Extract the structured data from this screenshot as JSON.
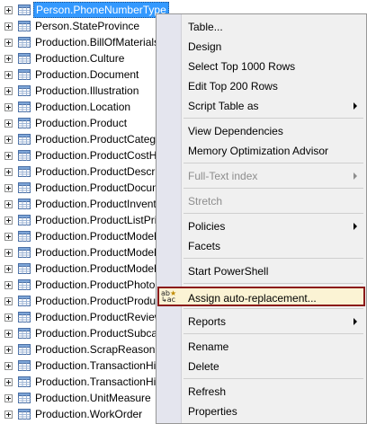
{
  "tree": {
    "items": [
      {
        "label": "Person.PhoneNumberType",
        "selected": true
      },
      {
        "label": "Person.StateProvince"
      },
      {
        "label": "Production.BillOfMaterials"
      },
      {
        "label": "Production.Culture"
      },
      {
        "label": "Production.Document"
      },
      {
        "label": "Production.Illustration"
      },
      {
        "label": "Production.Location"
      },
      {
        "label": "Production.Product"
      },
      {
        "label": "Production.ProductCategory"
      },
      {
        "label": "Production.ProductCostHistory"
      },
      {
        "label": "Production.ProductDescription"
      },
      {
        "label": "Production.ProductDocument"
      },
      {
        "label": "Production.ProductInventory"
      },
      {
        "label": "Production.ProductListPriceHistory"
      },
      {
        "label": "Production.ProductModel"
      },
      {
        "label": "Production.ProductModelIllustration"
      },
      {
        "label": "Production.ProductModelProductDescriptionCulture"
      },
      {
        "label": "Production.ProductPhoto"
      },
      {
        "label": "Production.ProductProductPhoto"
      },
      {
        "label": "Production.ProductReview"
      },
      {
        "label": "Production.ProductSubcategory"
      },
      {
        "label": "Production.ScrapReason"
      },
      {
        "label": "Production.TransactionHistory"
      },
      {
        "label": "Production.TransactionHistoryArchive"
      },
      {
        "label": "Production.UnitMeasure"
      },
      {
        "label": "Production.WorkOrder"
      }
    ]
  },
  "context_menu": {
    "items": [
      {
        "label": "Table...",
        "name": "menu-table"
      },
      {
        "label": "Design",
        "name": "menu-design"
      },
      {
        "label": "Select Top 1000 Rows",
        "name": "menu-select-top-1000-rows"
      },
      {
        "label": "Edit Top 200 Rows",
        "name": "menu-edit-top-200-rows"
      },
      {
        "label": "Script Table as",
        "name": "menu-script-table-as",
        "submenu": true
      },
      {
        "separator": true
      },
      {
        "label": "View Dependencies",
        "name": "menu-view-dependencies"
      },
      {
        "label": "Memory Optimization Advisor",
        "name": "menu-memory-optimization-advisor"
      },
      {
        "separator": true
      },
      {
        "label": "Full-Text index",
        "name": "menu-full-text-index",
        "submenu": true,
        "disabled": true
      },
      {
        "separator": true
      },
      {
        "label": "Stretch",
        "name": "menu-stretch",
        "disabled": true
      },
      {
        "separator": true
      },
      {
        "label": "Policies",
        "name": "menu-policies",
        "submenu": true
      },
      {
        "label": "Facets",
        "name": "menu-facets"
      },
      {
        "separator": true
      },
      {
        "label": "Start PowerShell",
        "name": "menu-start-powershell"
      },
      {
        "separator": true
      },
      {
        "label": "Assign auto-replacement...",
        "name": "menu-assign-auto-replacement",
        "highlight": true,
        "icon": "auto-replace-icon"
      },
      {
        "separator": true
      },
      {
        "label": "Reports",
        "name": "menu-reports",
        "submenu": true
      },
      {
        "separator": true
      },
      {
        "label": "Rename",
        "name": "menu-rename"
      },
      {
        "label": "Delete",
        "name": "menu-delete"
      },
      {
        "separator": true
      },
      {
        "label": "Refresh",
        "name": "menu-refresh"
      },
      {
        "label": "Properties",
        "name": "menu-properties"
      }
    ]
  },
  "colors": {
    "selection": "#3399ff",
    "highlight_border": "#8b1a1a",
    "highlight_fill": "#fbf3d4",
    "menu_bg": "#f0f0f0",
    "disabled_text": "#8d8d8d"
  }
}
